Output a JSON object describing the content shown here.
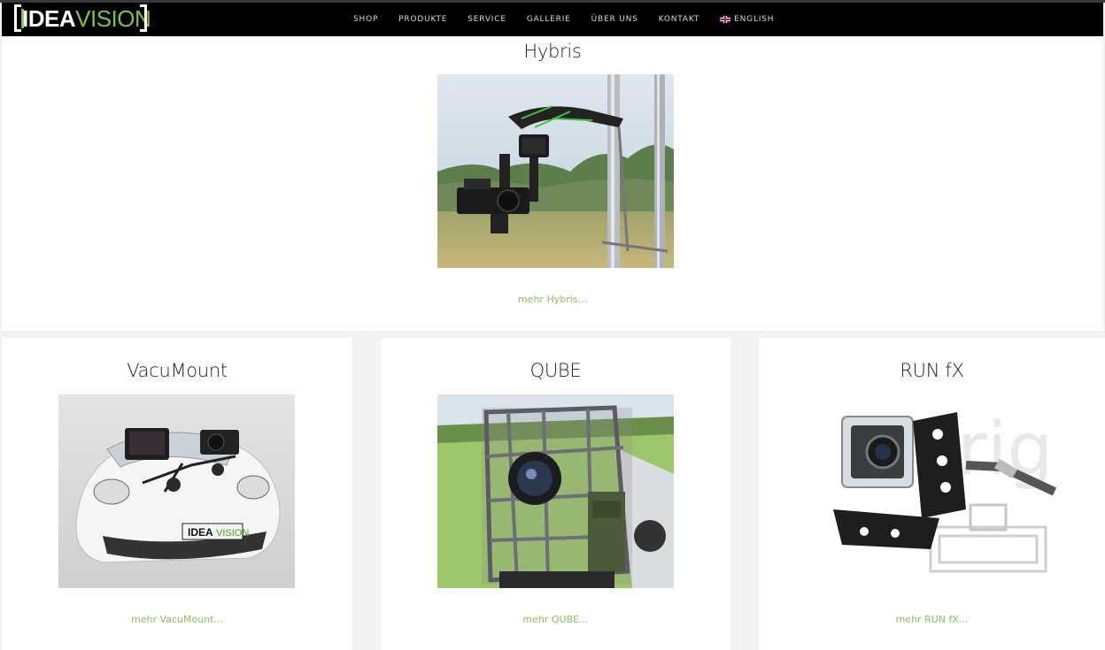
{
  "header": {
    "logo": {
      "idea": "IDEA",
      "vision": "VISION"
    },
    "nav": [
      {
        "label": "SHOP"
      },
      {
        "label": "PRODUKTE"
      },
      {
        "label": "SERVICE"
      },
      {
        "label": "GALLERIE"
      },
      {
        "label": "ÜBER UNS"
      },
      {
        "label": "KONTAKT"
      },
      {
        "label": "ENGLISH",
        "icon": "uk-flag-icon"
      }
    ]
  },
  "featured": {
    "title": "Hybris",
    "image": "hybris-gimbal-photo",
    "link": "mehr Hybris..."
  },
  "products": [
    {
      "title": "VacuMount",
      "image": "vacumount-car-photo",
      "link": "mehr VacuMount..."
    },
    {
      "title": "QUBE",
      "image": "qube-rig-photo",
      "link": "mehr QUBE..."
    },
    {
      "title": "RUN fX",
      "image": "runfx-gimbal-photo",
      "link": "mehr RUN fX..."
    }
  ],
  "colors": {
    "accent": "#7cc242",
    "link": "#8fbf5a",
    "navbar": "#000000",
    "page_bg": "#f2f2f2"
  }
}
